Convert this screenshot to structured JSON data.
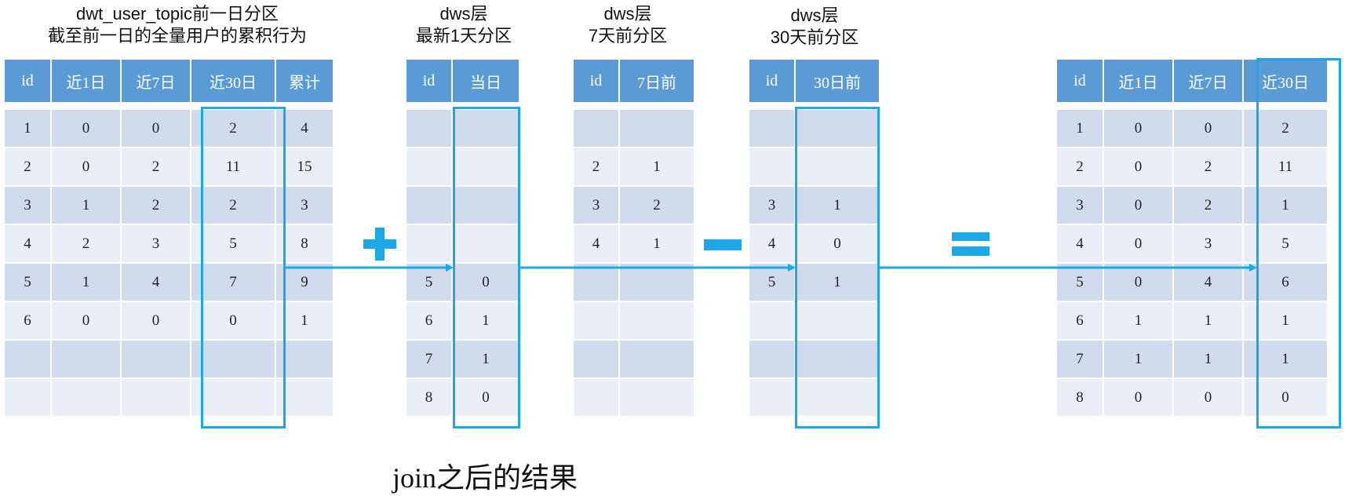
{
  "titles": {
    "t1_line1": "dwt_user_topic前一日分区",
    "t1_line2": "截至前一日的全量用户的累积行为",
    "t2_line1": "dws层",
    "t2_line2": "最新1天分区",
    "t3_line1": "dws层",
    "t3_line2": "7天前分区",
    "t4_line1": "dws层",
    "t4_line2": "30天前分区"
  },
  "table1": {
    "headers": [
      "id",
      "近1日",
      "近7日",
      "近30日",
      "累计"
    ],
    "rows": [
      [
        "1",
        "0",
        "0",
        "2",
        "4"
      ],
      [
        "2",
        "0",
        "2",
        "11",
        "15"
      ],
      [
        "3",
        "1",
        "2",
        "2",
        "3"
      ],
      [
        "4",
        "2",
        "3",
        "5",
        "8"
      ],
      [
        "5",
        "1",
        "4",
        "7",
        "9"
      ],
      [
        "6",
        "0",
        "0",
        "0",
        "1"
      ],
      [
        "",
        "",
        "",
        "",
        ""
      ],
      [
        "",
        "",
        "",
        "",
        ""
      ]
    ]
  },
  "table2": {
    "headers": [
      "id",
      "当日"
    ],
    "rows": [
      [
        "",
        ""
      ],
      [
        "",
        ""
      ],
      [
        "",
        ""
      ],
      [
        "",
        ""
      ],
      [
        "5",
        "0"
      ],
      [
        "6",
        "1"
      ],
      [
        "7",
        "1"
      ],
      [
        "8",
        "0"
      ]
    ]
  },
  "table3": {
    "headers": [
      "id",
      "7日前"
    ],
    "rows": [
      [
        "",
        ""
      ],
      [
        "2",
        "1"
      ],
      [
        "3",
        "2"
      ],
      [
        "4",
        "1"
      ],
      [
        "",
        ""
      ],
      [
        "",
        ""
      ],
      [
        "",
        ""
      ],
      [
        "",
        ""
      ]
    ]
  },
  "table4": {
    "headers": [
      "id",
      "30日前"
    ],
    "rows": [
      [
        "",
        ""
      ],
      [
        "",
        ""
      ],
      [
        "3",
        "1"
      ],
      [
        "4",
        "0"
      ],
      [
        "5",
        "1"
      ],
      [
        "",
        ""
      ],
      [
        "",
        ""
      ],
      [
        "",
        ""
      ]
    ]
  },
  "table5": {
    "headers": [
      "id",
      "近1日",
      "近7日",
      "近30日"
    ],
    "rows": [
      [
        "1",
        "0",
        "0",
        "2"
      ],
      [
        "2",
        "0",
        "2",
        "11"
      ],
      [
        "3",
        "0",
        "2",
        "1"
      ],
      [
        "4",
        "0",
        "3",
        "5"
      ],
      [
        "5",
        "0",
        "4",
        "6"
      ],
      [
        "6",
        "1",
        "1",
        "1"
      ],
      [
        "7",
        "1",
        "1",
        "1"
      ],
      [
        "8",
        "0",
        "0",
        "0"
      ]
    ]
  },
  "operators": {
    "plus": "+",
    "minus": "−",
    "equals": "="
  },
  "caption": "join之后的结果",
  "colors": {
    "header": "#5b9bd5",
    "row_odd": "#d0dcee",
    "row_even": "#e9eef7",
    "accent": "#1aa8e8"
  }
}
